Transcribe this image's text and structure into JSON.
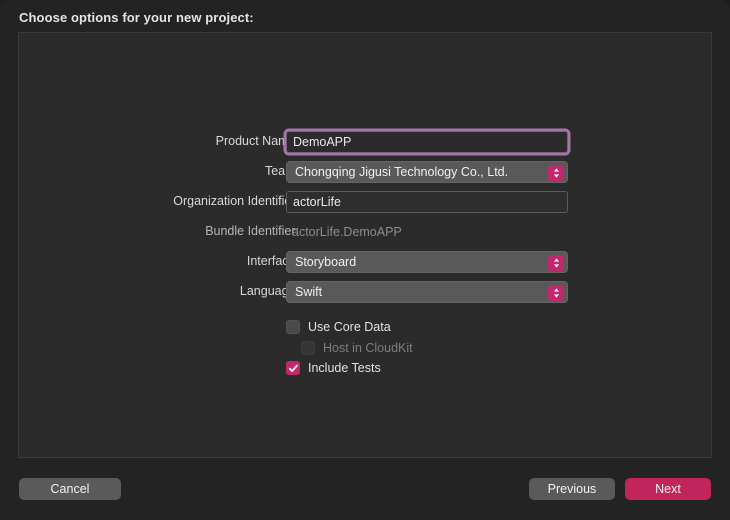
{
  "window": {
    "title": "Choose options for your new project:"
  },
  "form": {
    "fields": [
      {
        "label": "Product Name:",
        "type": "text",
        "value": "DemoAPP",
        "focused": true,
        "name": "product-name"
      },
      {
        "label": "Team:",
        "type": "popup",
        "value": "Chongqing Jigusi Technology Co., Ltd.",
        "name": "team"
      },
      {
        "label": "Organization Identifier:",
        "type": "text",
        "value": "actorLife",
        "focused": false,
        "name": "organization-identifier"
      },
      {
        "label": "Bundle Identifier:",
        "type": "static",
        "value": "actorLife.DemoAPP",
        "name": "bundle-identifier"
      },
      {
        "label": "Interface:",
        "type": "popup",
        "value": "Storyboard",
        "name": "interface"
      },
      {
        "label": "Language:",
        "type": "popup",
        "value": "Swift",
        "name": "language"
      }
    ],
    "checkboxes": [
      {
        "label": "Use Core Data",
        "checked": false,
        "disabled": false,
        "indent": 0,
        "name": "use-core-data"
      },
      {
        "label": "Host in CloudKit",
        "checked": false,
        "disabled": true,
        "indent": 15,
        "name": "host-in-cloudkit"
      },
      {
        "label": "Include Tests",
        "checked": true,
        "disabled": false,
        "indent": 0,
        "name": "include-tests"
      }
    ]
  },
  "footer": {
    "cancel_label": "Cancel",
    "previous_label": "Previous",
    "next_label": "Next"
  },
  "colors": {
    "accent": "#c2255c",
    "stepper": "#c2266c",
    "focus_ring": "#a477a8",
    "window_bg": "#232323",
    "panel_bg": "#2b2b2b"
  },
  "icons": {
    "stepper": "chevron-up-down-icon",
    "check": "checkmark-icon"
  }
}
